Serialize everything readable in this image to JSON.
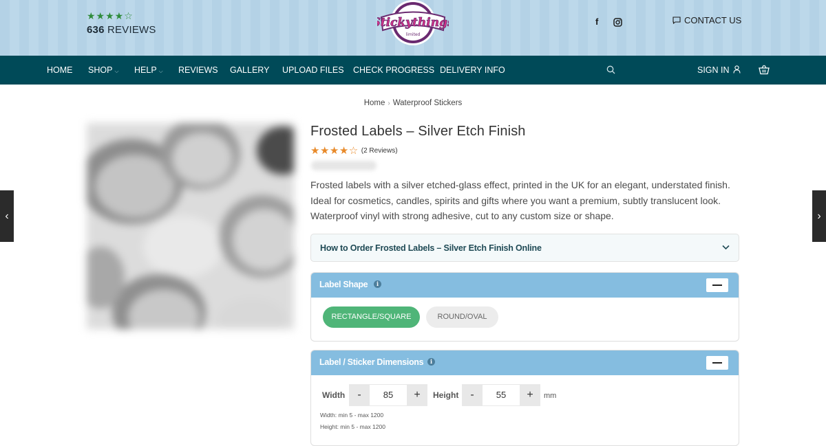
{
  "header": {
    "rating_stars": "★★★★☆",
    "review_count_number": "636",
    "review_count_label": "REVIEWS",
    "logo_text": "Stickythings",
    "logo_subtext": "limited",
    "social": [
      "facebook-icon",
      "instagram-icon"
    ],
    "contact_label": "CONTACT US"
  },
  "nav": {
    "items": [
      "HOME",
      "SHOP",
      "HELP",
      "REVIEWS",
      "GALLERY",
      "UPLOAD FILES",
      "CHECK PROGRESS",
      "DELIVERY INFO"
    ],
    "sign_in": "SIGN IN"
  },
  "breadcrumb": {
    "home": "Home",
    "current": "Waterproof Stickers"
  },
  "product": {
    "title": "Frosted Labels – Silver Etch Finish",
    "stars": "★★★★☆",
    "rating_value": 4.5,
    "reviews": "(2 Reviews)",
    "description": "Frosted labels with a silver etched-glass effect, printed in the UK for an elegant, understated finish. Ideal for cosmetics, candles, spirits and gifts where you want a premium, subtly translucent look. Waterproof vinyl with strong adhesive, cut to any custom size or shape."
  },
  "how_to_order": {
    "label": "How to Order Frosted Labels – Silver Etch Finish Online"
  },
  "label_shape": {
    "title": "Label Shape",
    "options": [
      "RECTANGLE/SQUARE",
      "ROUND/OVAL"
    ],
    "selected": "RECTANGLE/SQUARE"
  },
  "dimensions": {
    "title": "Label / Sticker Dimensions",
    "width_label": "Width",
    "width_value": "85",
    "height_label": "Height",
    "height_value": "55",
    "unit": "mm",
    "minus": "-",
    "plus": "+",
    "width_hint": "Width: min 5 - max 1200",
    "height_hint": "Height: min 5 - max 1200"
  },
  "colors": {
    "nav_bg": "#004a58",
    "header_bg": "#b4d2e6",
    "panel_head": "#85bde0",
    "active_green": "#4fb578",
    "star_orange": "#e88a2a",
    "star_green": "#2e8b3a"
  }
}
